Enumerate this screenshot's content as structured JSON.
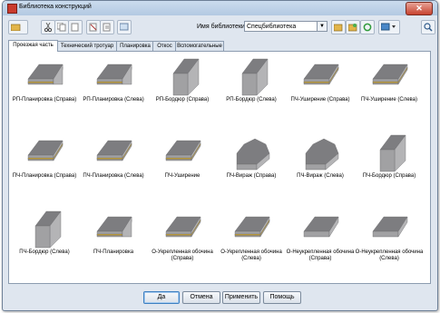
{
  "window": {
    "title": "Библиотека конструкций",
    "close_symbol": "✕"
  },
  "toolbar": {
    "library_label": "Имя библиотеки:",
    "library_value": "Спецбиблиотека",
    "buttons": [
      "folder-open-icon",
      "cut-icon",
      "copy-icon",
      "paste-icon",
      "delete-icon",
      "properties-icon",
      "pencil-icon",
      "save-icon",
      "refresh-icon",
      "image-view-icon",
      "search-icon"
    ]
  },
  "tabs": [
    {
      "label": "Проезжая часть",
      "active": true
    },
    {
      "label": "Технический тротуар",
      "active": false
    },
    {
      "label": "Планировка",
      "active": false
    },
    {
      "label": "Откос",
      "active": false
    },
    {
      "label": "Вспомогательные",
      "active": false
    }
  ],
  "items": [
    {
      "label": "РП-Планировка (Справа)",
      "shape": "plate-yellow-ramp"
    },
    {
      "label": "РП-Планировка (Слева)",
      "shape": "plate-yellow-ramp"
    },
    {
      "label": "РП-Бордюр (Справа)",
      "shape": "block-tall"
    },
    {
      "label": "РП-Бордюр (Слева)",
      "shape": "block-tall"
    },
    {
      "label": "ПЧ-Уширение (Справа)",
      "shape": "plate-yellow"
    },
    {
      "label": "ПЧ-Уширение (Слева)",
      "shape": "plate-yellow"
    },
    {
      "label": "ПЧ-Планировка (Справа)",
      "shape": "plate-yellow"
    },
    {
      "label": "ПЧ-Планировка (Слева)",
      "shape": "plate-yellow"
    },
    {
      "label": "ПЧ-Уширение",
      "shape": "plate-yellow"
    },
    {
      "label": "ПЧ-Вираж (Справа)",
      "shape": "plate-curved"
    },
    {
      "label": "ПЧ-Вираж (Слева)",
      "shape": "plate-curved"
    },
    {
      "label": "ПЧ-Бордюр (Справа)",
      "shape": "block-tall"
    },
    {
      "label": "ПЧ-Бордюр (Слева)",
      "shape": "block-tall"
    },
    {
      "label": "ПЧ-Планировка",
      "shape": "plate-yellow-ramp"
    },
    {
      "label": "О-Укрепленная обочина (Справа)",
      "shape": "plate-yellow"
    },
    {
      "label": "О-Укрепленная обочина (Слева)",
      "shape": "plate-yellow"
    },
    {
      "label": "О-Неукрепленная обочина (Справа)",
      "shape": "plate-gray"
    },
    {
      "label": "О-Неукрепленная обочина (Слева)",
      "shape": "plate-gray"
    }
  ],
  "footer": {
    "ok": "Да",
    "cancel": "Отмена",
    "apply": "Применить",
    "help": "Помощь"
  },
  "colors": {
    "top": "#7d7d80",
    "side": "#b4b4b6",
    "front": "#a1a1a3",
    "band": "#c9a12c"
  }
}
